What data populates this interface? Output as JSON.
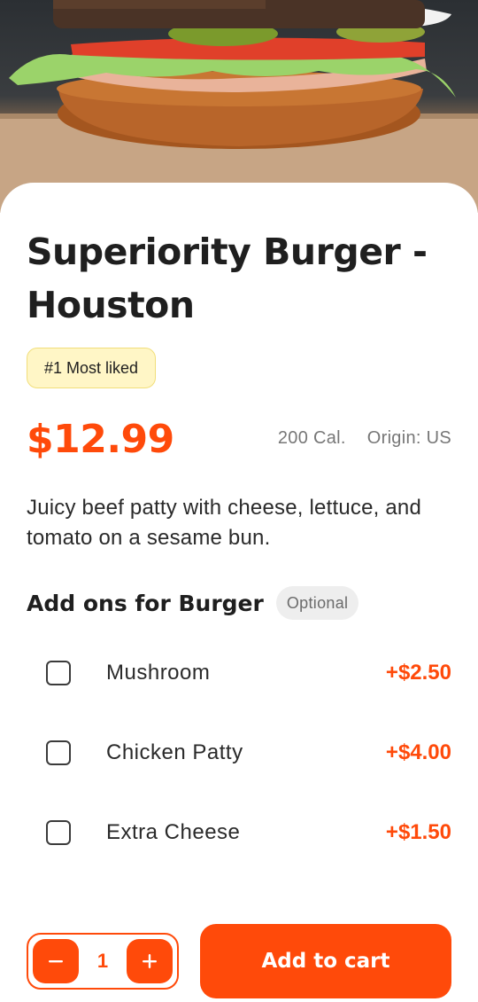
{
  "hero": {
    "image": "burger-photo"
  },
  "product": {
    "title": "Superiority Burger - Houston",
    "badge": "#1 Most liked",
    "price": "$12.99",
    "calories": "200 Cal.",
    "origin": "Origin: US",
    "description": "Juicy beef patty with cheese, lettuce, and tomato on a sesame bun."
  },
  "addons": {
    "title": "Add ons for Burger",
    "tag": "Optional",
    "items": [
      {
        "label": "Mushroom",
        "price": "+$2.50",
        "checked": false
      },
      {
        "label": "Chicken Patty",
        "price": "+$4.00",
        "checked": false
      },
      {
        "label": "Extra Cheese",
        "price": "+$1.50",
        "checked": false
      }
    ]
  },
  "cart": {
    "quantity": "1",
    "minus_icon": "minus-icon",
    "plus_icon": "plus-icon",
    "add_label": "Add to cart"
  },
  "colors": {
    "accent": "#ff4a0a",
    "badge_bg": "#fff6c6",
    "tag_bg": "#eeeeee"
  }
}
